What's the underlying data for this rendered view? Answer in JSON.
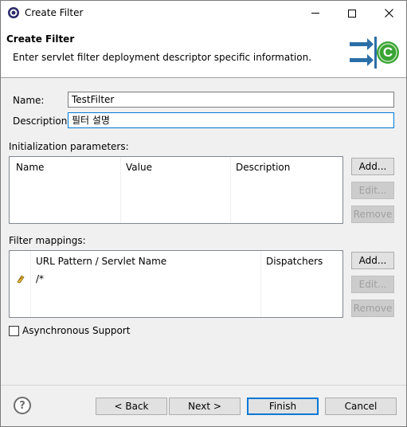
{
  "window": {
    "title": "Create Filter",
    "minimize": "—",
    "maximize": "☐",
    "close": "✕"
  },
  "banner": {
    "title": "Create Filter",
    "description": "Enter servlet filter deployment descriptor specific information.",
    "icon_letter": "C"
  },
  "form": {
    "name_label": "Name:",
    "name_value": "TestFilter",
    "description_label": "Description:",
    "description_value": "필터 설명"
  },
  "init_params": {
    "label": "Initialization parameters:",
    "columns": [
      "Name",
      "Value",
      "Description"
    ],
    "add": "Add...",
    "edit": "Edit...",
    "remove": "Remove"
  },
  "filter_mappings": {
    "label": "Filter mappings:",
    "columns": [
      "URL Pattern / Servlet Name",
      "Dispatchers"
    ],
    "rows": [
      {
        "pattern": "/*",
        "dispatchers": ""
      }
    ],
    "add": "Add...",
    "edit": "Edit...",
    "remove": "Remove"
  },
  "async_support": {
    "label": "Asynchronous Support",
    "checked": false
  },
  "footer": {
    "help": "?",
    "back": "< Back",
    "next": "Next >",
    "finish": "Finish",
    "cancel": "Cancel"
  },
  "colors": {
    "accent": "#0078d7",
    "icon_green": "#3aa335",
    "arrow_blue": "#2a6ea6"
  },
  "icons": [
    "app-icon",
    "filter-arrows-icon",
    "mapping-row-icon",
    "help-icon"
  ]
}
